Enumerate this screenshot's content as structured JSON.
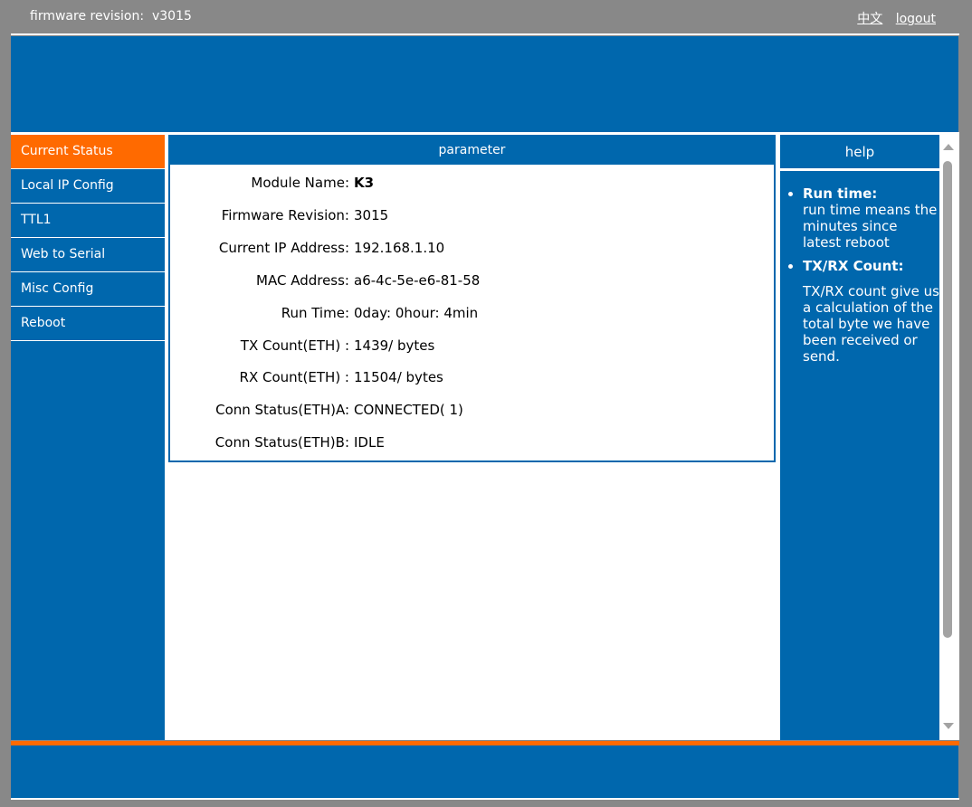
{
  "header": {
    "firmware_label": "firmware revision:  v3015",
    "lang_link": "中文",
    "logout_link": "logout"
  },
  "sidebar": {
    "items": [
      {
        "label": "Current Status",
        "active": true
      },
      {
        "label": "Local IP Config"
      },
      {
        "label": "TTL1"
      },
      {
        "label": "Web to Serial"
      },
      {
        "label": "Misc Config"
      },
      {
        "label": "Reboot"
      }
    ]
  },
  "parameter": {
    "title": "parameter",
    "rows": [
      {
        "label": "Module Name:",
        "value": "K3"
      },
      {
        "label": "Firmware Revision:",
        "value": "3015"
      },
      {
        "label": "Current IP Address:",
        "value": "192.168.1.10"
      },
      {
        "label": "MAC Address:",
        "value": "a6-4c-5e-e6-81-58"
      },
      {
        "label": "Run Time:",
        "value": "0day: 0hour: 4min"
      },
      {
        "label": "TX Count(ETH) :",
        "value": "1439/ bytes"
      },
      {
        "label": "RX Count(ETH) :",
        "value": "11504/ bytes"
      },
      {
        "label": "Conn Status(ETH)A:",
        "value": "CONNECTED( 1)"
      },
      {
        "label": "Conn Status(ETH)B:",
        "value": "IDLE"
      }
    ]
  },
  "help": {
    "title": "help",
    "items": [
      {
        "term": "Run time:",
        "text": "run time means the minutes since latest reboot"
      },
      {
        "term": "TX/RX Count:",
        "text": "TX/RX count give us a calculation of the total byte we have been received or send."
      }
    ]
  },
  "colors": {
    "brand_blue": "#0067ad",
    "accent_orange": "#ff6a00",
    "frame_gray": "#888888"
  }
}
